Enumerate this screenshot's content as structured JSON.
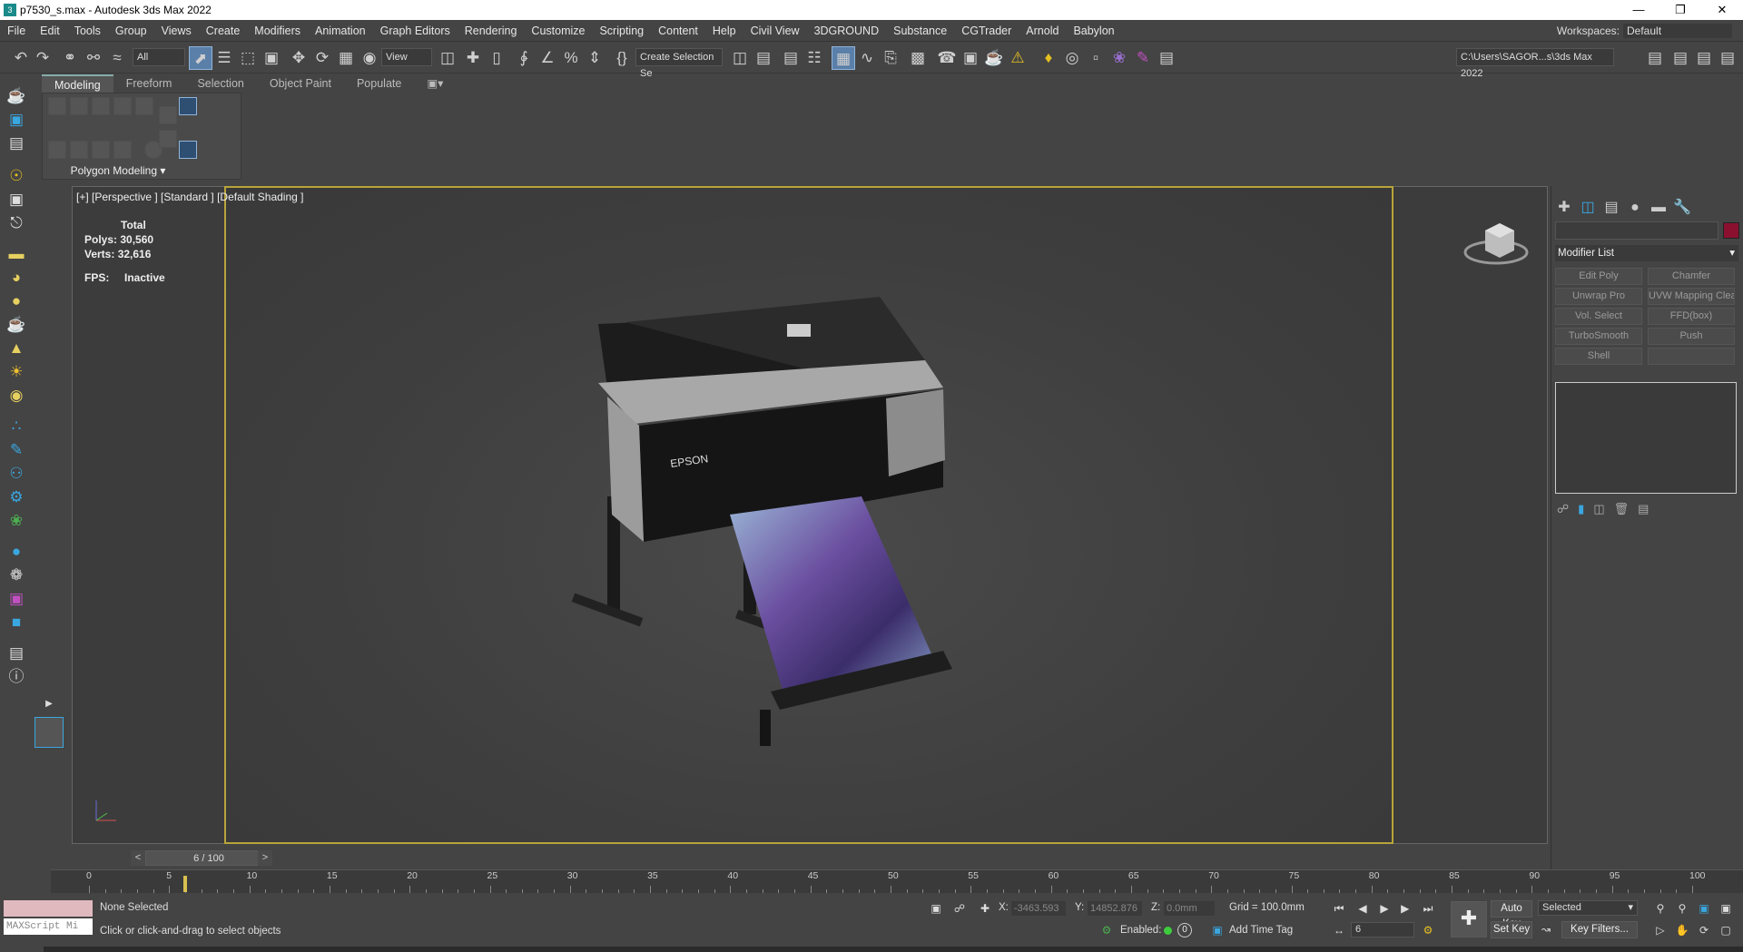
{
  "window": {
    "title": "p7530_s.max - Autodesk 3ds Max 2022",
    "app_icon": "3ds-max-icon"
  },
  "menu": [
    "File",
    "Edit",
    "Tools",
    "Group",
    "Views",
    "Create",
    "Modifiers",
    "Animation",
    "Graph Editors",
    "Rendering",
    "Customize",
    "Scripting",
    "Content",
    "Help",
    "Civil View",
    "3DGROUND",
    "Substance",
    "CGTrader",
    "Arnold",
    "Babylon"
  ],
  "workspaces": {
    "label": "Workspaces:",
    "value": "Default"
  },
  "toolbar": {
    "filter": "All",
    "ref_coord": "View",
    "selection_set": "Create Selection Se",
    "project_path": "C:\\Users\\SAGOR...s\\3ds Max 2022"
  },
  "ribbon": {
    "tabs": [
      "Modeling",
      "Freeform",
      "Selection",
      "Object Paint",
      "Populate"
    ],
    "active": "Modeling",
    "panel_label": "Polygon Modeling"
  },
  "viewport": {
    "label": "[+] [Perspective ] [Standard ] [Default Shading ]",
    "stats": {
      "total_label": "Total",
      "polys_label": "Polys:",
      "polys": "30,560",
      "verts_label": "Verts:",
      "verts": "32,616",
      "fps_label": "FPS:",
      "fps": "Inactive"
    },
    "printer_brand": "EPSON"
  },
  "command_panel": {
    "modifier_list": "Modifier List",
    "modifiers": [
      "Edit Poly",
      "Chamfer",
      "Unwrap Pro",
      "UVW Mapping Clear",
      "Vol. Select",
      "FFD(box)",
      "TurboSmooth",
      "Push",
      "Shell",
      ""
    ],
    "object_color": "#8b1030"
  },
  "timeline": {
    "frame": "6 / 100",
    "prev": "<",
    "next": ">",
    "ticks": [
      "0",
      "5",
      "10",
      "15",
      "20",
      "25",
      "30",
      "35",
      "40",
      "45",
      "50",
      "55",
      "60",
      "65",
      "70",
      "75",
      "80",
      "85",
      "90",
      "95",
      "100"
    ],
    "current": 6
  },
  "status": {
    "selection": "None Selected",
    "prompt": "Click or click-and-drag to select objects",
    "maxscript_placeholder": "MAXScript Mi",
    "x_label": "X:",
    "x": "-3463.593",
    "y_label": "Y:",
    "y": "14852.876",
    "z_label": "Z:",
    "z": "0.0mm",
    "grid": "Grid = 100.0mm",
    "enabled": "Enabled:",
    "enabled_count": "0",
    "add_time_tag": "Add Time Tag",
    "frame_field": "6",
    "auto_key": "Auto Key",
    "set_key": "Set Key",
    "key_mode": "Selected",
    "key_filters": "Key Filters..."
  }
}
